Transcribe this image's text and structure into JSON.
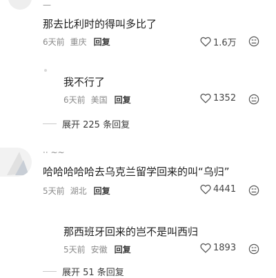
{
  "comments": [
    {
      "username": "—",
      "text": "那去比利时的得叫多比了",
      "time": "6天前",
      "location": "重庆",
      "reply_label": "回复",
      "likes": "1.6万"
    },
    {
      "text": "我不行了",
      "time": "6天前",
      "location": "美国",
      "reply_label": "回复",
      "likes": "1352"
    },
    {
      "expand_label": "展开 225 条回复"
    },
    {
      "username": "·· ~~",
      "text": "哈哈哈哈哈去乌克兰留学回来的叫“乌归”",
      "time": "5天前",
      "location": "湖北",
      "reply_label": "回复",
      "likes": "4441"
    },
    {
      "text": "那西班牙回来的岂不是叫西归",
      "time": "5天前",
      "location": "安徽",
      "reply_label": "回复",
      "likes": "1893"
    },
    {
      "expand_label": "展开 51 条回复"
    }
  ],
  "icons": {
    "like": "heart-outline-icon",
    "dislike": "unhappy-face-icon"
  },
  "colors": {
    "meta_text": "#8a8a8a",
    "reply_text": "#3a3a3a",
    "avatar_placeholder": "#eeeeee"
  }
}
